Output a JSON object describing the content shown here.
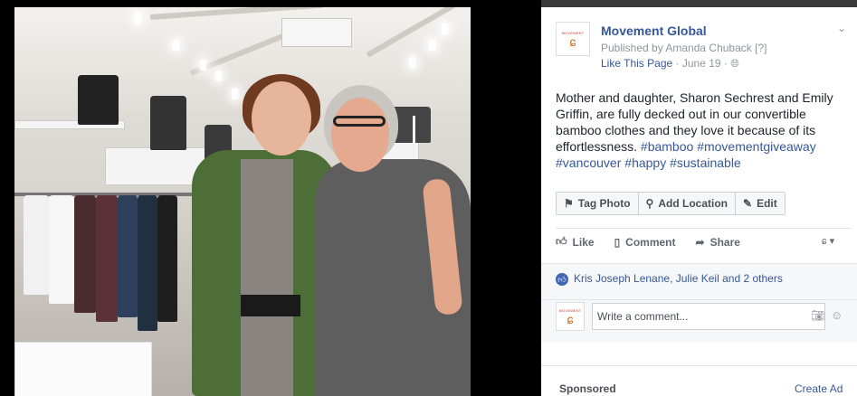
{
  "post": {
    "page_name": "Movement Global",
    "published_by": "Published by Amanda Chuback",
    "published_q": "[?]",
    "like_page": "Like This Page",
    "date": "June 19",
    "text_plain": "Mother and daughter, Sharon Sechrest and Emily Griffin, are fully decked out in our convertible bamboo clothes and they love it because of its effortlessness. ",
    "hashtags": [
      "#bamboo",
      "#movementgiveaway",
      "#vancouver",
      "#happy",
      "#sustainable"
    ]
  },
  "photo_actions": {
    "tag_photo": "Tag Photo",
    "add_location": "Add Location",
    "edit": "Edit"
  },
  "ufi": {
    "like": "Like",
    "comment": "Comment",
    "share": "Share"
  },
  "reactions": {
    "likers": "Kris Joseph Lenane, Julie Keil and 2 others"
  },
  "comment_box": {
    "placeholder": "Write a comment..."
  },
  "sidebar": {
    "sponsored": "Sponsored",
    "create_ad": "Create Ad"
  },
  "logo": {
    "text": "MOVEMENT",
    "swirl": "ɕ"
  },
  "colors": {
    "link": "#365899",
    "muted": "#90949c",
    "jacket": "#4d6e37"
  }
}
